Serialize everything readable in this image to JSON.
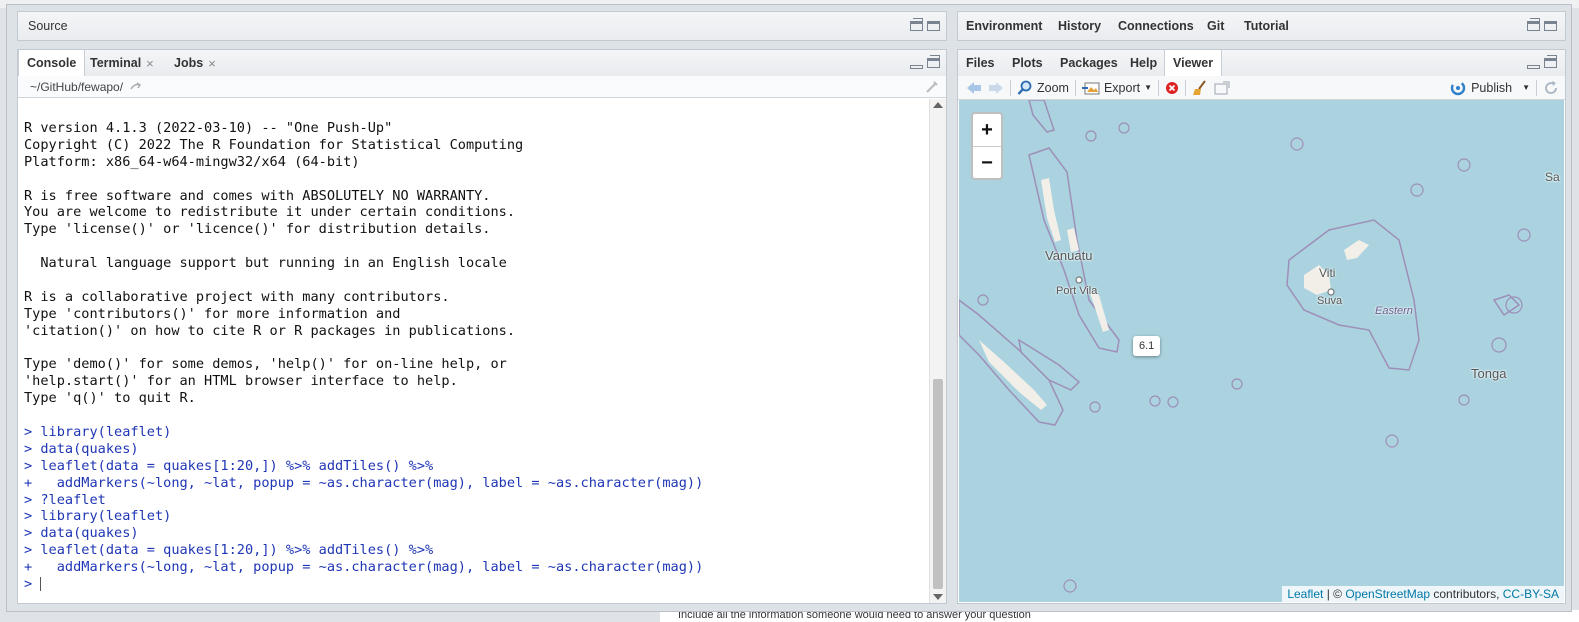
{
  "source_pane": {
    "title": "Source"
  },
  "console_pane": {
    "tabs": [
      {
        "label": "Console",
        "active": true
      },
      {
        "label": "Terminal",
        "closable": true
      },
      {
        "label": "Jobs",
        "closable": true
      }
    ],
    "path": "~/GitHub/fewapo/",
    "lines": [
      {
        "type": "out",
        "text": "R version 4.1.3 (2022-03-10) -- \"One Push-Up\""
      },
      {
        "type": "out",
        "text": "Copyright (C) 2022 The R Foundation for Statistical Computing"
      },
      {
        "type": "out",
        "text": "Platform: x86_64-w64-mingw32/x64 (64-bit)"
      },
      {
        "type": "out",
        "text": ""
      },
      {
        "type": "out",
        "text": "R is free software and comes with ABSOLUTELY NO WARRANTY."
      },
      {
        "type": "out",
        "text": "You are welcome to redistribute it under certain conditions."
      },
      {
        "type": "out",
        "text": "Type 'license()' or 'licence()' for distribution details."
      },
      {
        "type": "out",
        "text": ""
      },
      {
        "type": "out",
        "text": "  Natural language support but running in an English locale"
      },
      {
        "type": "out",
        "text": ""
      },
      {
        "type": "out",
        "text": "R is a collaborative project with many contributors."
      },
      {
        "type": "out",
        "text": "Type 'contributors()' for more information and"
      },
      {
        "type": "out",
        "text": "'citation()' on how to cite R or R packages in publications."
      },
      {
        "type": "out",
        "text": ""
      },
      {
        "type": "out",
        "text": "Type 'demo()' for some demos, 'help()' for on-line help, or"
      },
      {
        "type": "out",
        "text": "'help.start()' for an HTML browser interface to help."
      },
      {
        "type": "out",
        "text": "Type 'q()' to quit R."
      },
      {
        "type": "out",
        "text": ""
      },
      {
        "type": "in",
        "text": "> library(leaflet)"
      },
      {
        "type": "in",
        "text": "> data(quakes)"
      },
      {
        "type": "in",
        "text": "> leaflet(data = quakes[1:20,]) %>% addTiles() %>%"
      },
      {
        "type": "in",
        "text": "+   addMarkers(~long, ~lat, popup = ~as.character(mag), label = ~as.character(mag))"
      },
      {
        "type": "in",
        "text": "> ?leaflet"
      },
      {
        "type": "in",
        "text": "> library(leaflet)"
      },
      {
        "type": "in",
        "text": "> data(quakes)"
      },
      {
        "type": "in",
        "text": "> leaflet(data = quakes[1:20,]) %>% addTiles() %>%"
      },
      {
        "type": "in",
        "text": "+   addMarkers(~long, ~lat, popup = ~as.character(mag), label = ~as.character(mag))"
      }
    ],
    "prompt": "> "
  },
  "env_pane": {
    "tabs": [
      "Environment",
      "History",
      "Connections",
      "Git",
      "Tutorial"
    ]
  },
  "files_pane": {
    "tabs": [
      "Files",
      "Plots",
      "Packages",
      "Help",
      "Viewer"
    ],
    "active_tab": "Viewer",
    "toolbar": {
      "zoom": "Zoom",
      "export": "Export",
      "publish": "Publish"
    }
  },
  "map": {
    "zoom_in": "+",
    "zoom_out": "−",
    "marker_label": "6.1",
    "labels": {
      "vanuatu": "Vanuatu",
      "port_vila": "Port Vila",
      "viti": "Viti",
      "suva": "Suva",
      "eastern": "Eastern",
      "tonga": "Tonga",
      "sa": "Sa"
    },
    "attribution": {
      "leaflet": "Leaflet",
      "sep": " | © ",
      "osm": "OpenStreetMap",
      "contributors": " contributors, ",
      "license": "CC-BY-SA"
    },
    "colors": {
      "sea": "#aad3df",
      "land": "#f2efe9",
      "border": "#9e8fb8"
    }
  },
  "background_text": "Include all the information someone would need to answer your question"
}
